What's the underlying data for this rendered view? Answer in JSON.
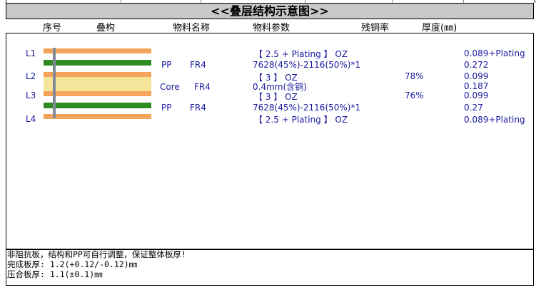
{
  "title": "<<叠层结构示意图>>",
  "headers": {
    "no": "序号",
    "stack": "叠构",
    "material_name": "物料名称",
    "material_param": "物料参数",
    "residual_copper": "残铜率",
    "thickness": "厚度(㎜)"
  },
  "layers": {
    "l1": "L1",
    "l2": "L2",
    "l3": "L3",
    "l4": "L4"
  },
  "rows": {
    "r1_param": "【 2.5 + Plating 】 OZ",
    "r1_thick": "0.089+Plating",
    "r2_name": "PP",
    "r2_mat": "FR4",
    "r2_param": "7628(45%)-2116(50%)*1",
    "r2_thick": "0.272",
    "r3_param": "【 3 】 OZ",
    "r3_copper": "78%",
    "r3_thick": "0.099",
    "r4_name": "Core",
    "r4_mat": "FR4",
    "r4_param": "0.4mm(含铜)",
    "r4_thick": "0.187",
    "r5_param": "【 3 】 OZ",
    "r5_copper": "76%",
    "r5_thick": "0.099",
    "r6_name": "PP",
    "r6_mat": "FR4",
    "r6_param": "7628(45%)-2116(50%)*1",
    "r6_thick": "0.27",
    "r7_param": "【 2.5 + Plating 】 OZ",
    "r7_thick": "0.089+Plating"
  },
  "notes": {
    "line1": "非阻抗板，结构和PP可自行调整，保证整体板厚!",
    "line2": "完成板厚: 1.2(+0.12/-0.12)㎜",
    "line3": "压合板厚: 1.1(±0.1)㎜"
  },
  "colors": {
    "copper": "#f4a35a",
    "prepreg": "#2e8b22",
    "core": "#f5e59a",
    "via": "#808a99",
    "text_blue": "#1a1aa0",
    "title_bg": "#c8c8c8"
  }
}
